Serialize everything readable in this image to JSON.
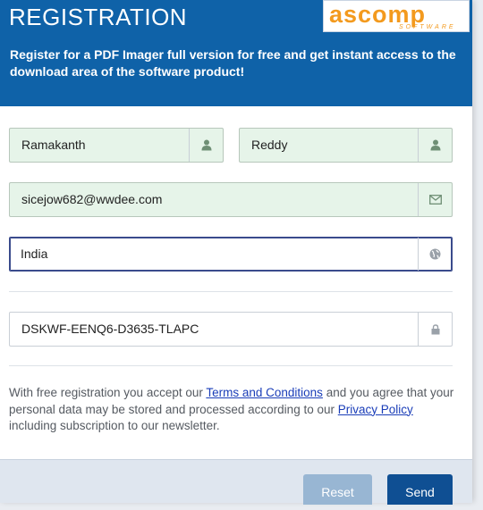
{
  "header": {
    "title": "REGISTRATION",
    "subtitle": "Register for a PDF Imager full version for free and get instant access to the download area of the software product!",
    "logo_text": "ascomp",
    "logo_subtext": "SOFTWARE"
  },
  "form": {
    "first_name": "Ramakanth",
    "last_name": "Reddy",
    "email": "sicejow682@wwdee.com",
    "country": "India",
    "code": "DSKWF-EENQ6-D3635-TLAPC"
  },
  "terms": {
    "pre": "With free registration you accept our ",
    "terms_link": "Terms and Conditions",
    "mid": " and you agree that your personal data may be stored and processed according to our ",
    "privacy_link": "Privacy Policy",
    "post": " including subscription to our newsletter."
  },
  "buttons": {
    "reset": "Reset",
    "send": "Send"
  },
  "colors": {
    "header_bg": "#0f62a8",
    "valid_field_bg": "#e6f4e9",
    "send_button": "#0f4f93",
    "reset_button": "#98b6d3",
    "logo_orange": "#f39a1e"
  }
}
